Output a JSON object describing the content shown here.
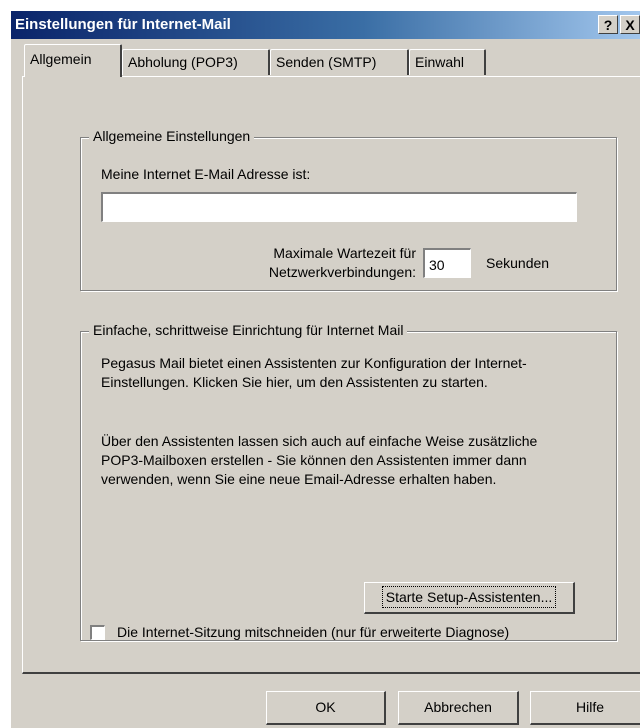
{
  "window": {
    "title": "Einstellungen für Internet-Mail",
    "help_glyph": "?",
    "close_glyph": "X"
  },
  "tabs": [
    {
      "label": "Allgemein",
      "active": true
    },
    {
      "label": "Abholung (POP3)",
      "active": false
    },
    {
      "label": "Senden (SMTP)",
      "active": false
    },
    {
      "label": "Einwahl",
      "active": false
    }
  ],
  "general_settings": {
    "legend": "Allgemeine Einstellungen",
    "email_label": "Meine Internet E-Mail Adresse ist:",
    "email_value": "",
    "timeout_label_line1": "Maximale Wartezeit für",
    "timeout_label_line2": "Netzwerkverbindungen:",
    "timeout_value": "30",
    "timeout_unit": "Sekunden"
  },
  "wizard": {
    "legend": "Einfache, schrittweise Einrichtung für Internet Mail",
    "paragraph1": "Pegasus Mail bietet einen Assistenten zur Konfiguration der Internet-Einstellungen. Klicken Sie hier, um den Assistenten zu starten.",
    "paragraph2": "Über den Assistenten lassen sich auch auf einfache Weise zusätzliche POP3-Mailboxen erstellen - Sie können den Assistenten immer dann verwenden, wenn Sie eine neue Email-Adresse erhalten haben.",
    "button_label": "Starte Setup-Assistenten..."
  },
  "diagnostics": {
    "checkbox_label": "Die Internet-Sitzung mitschneiden (nur für erweiterte Diagnose)",
    "checked": false
  },
  "buttons": {
    "ok": "OK",
    "cancel": "Abbrechen",
    "help": "Hilfe"
  }
}
